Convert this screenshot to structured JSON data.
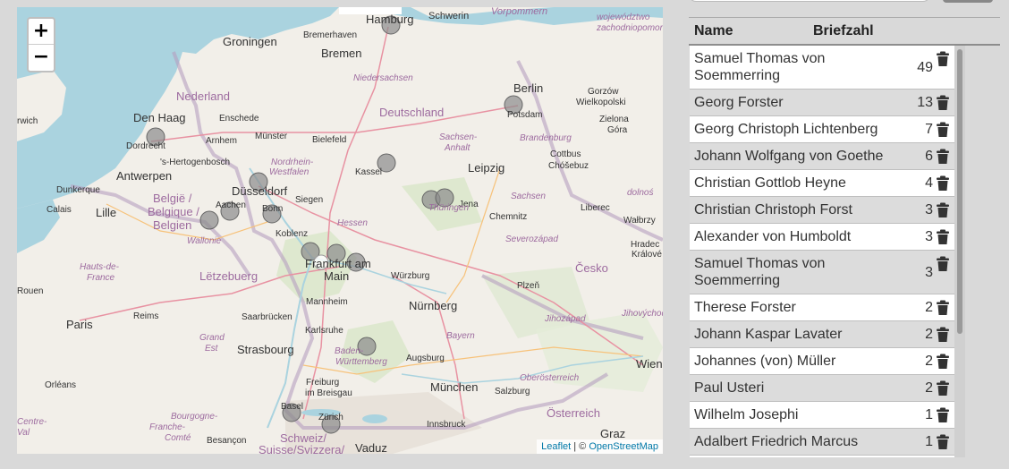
{
  "map": {
    "zoom_in": "+",
    "zoom_out": "−",
    "attribution": {
      "leaflet": "Leaflet",
      "sep": " | © ",
      "osm": "OpenStreetMap"
    },
    "labels": {
      "hamburg": "Hamburg",
      "schwerin": "Schwerin",
      "vorpommern": "Vorpommern",
      "woj": "województwo",
      "woj2": "zachodniopomorskie",
      "groningen": "Groningen",
      "bremerhaven": "Bremerhaven",
      "bremen": "Bremen",
      "nedersaksen": "Nederland",
      "niedersachsen": "Niedersachsen",
      "berlin": "Berlin",
      "potsdam": "Potsdam",
      "gorzow": "Gorzów",
      "wielkopolski": "Wielkopolski",
      "zielona": "Zielona",
      "gora": "Góra",
      "norwich": "rwich",
      "denhaag": "Den Haag",
      "enschede": "Enschede",
      "deutschland": "Deutschland",
      "munster": "Münster",
      "bielefeld": "Bielefeld",
      "dordrecht": "Dordrecht",
      "arnhem": "Arnhem",
      "sachsen_anhalt": "Sachsen-",
      "anhalt": "Anhalt",
      "brandenburg": "Brandenburg",
      "cottbus": "Cottbus",
      "chosebuz": "Chóšebuz",
      "hertogenbosch": "'s-Hertogenbosch",
      "nrw": "Nordrhein-",
      "westfalen": "Westfalen",
      "kassel": "Kassel",
      "leipzig": "Leipzig",
      "antwerpen": "Antwerpen",
      "dunkerque": "Dunkerque",
      "dusseldorf": "Düsseldorf",
      "siegen": "Siegen",
      "jena": "Jena",
      "sachsen": "Sachsen",
      "dolno": "dolnoś",
      "calais": "Calais",
      "lille": "Lille",
      "belgie": "België /",
      "belgique": "Belgique /",
      "belgien": "Belgien",
      "aachen": "Aachen",
      "bonn": "Bonn",
      "hessen": "Hessen",
      "thuringen": "Thüringen",
      "chemnitz": "Chemnitz",
      "liberec": "Liberec",
      "walbrzych": "Wałbrzy",
      "wallonie": "Wallonie",
      "koblenz": "Koblenz",
      "severo": "Severozápad",
      "hradec": "Hradec",
      "kralove": "Králové",
      "hauts": "Hauts-de-",
      "france": "France",
      "letzebuerg": "Lëtzebuerg",
      "frankfurt": "Frankfurt am",
      "main": "Main",
      "wurzburg": "Würzburg",
      "cesko": "Česko",
      "rouen": "Rouen",
      "mannheim": "Mannheim",
      "plzen": "Plzeň",
      "nurnberg": "Nürnberg",
      "paris": "Paris",
      "reims": "Reims",
      "saarbrucken": "Saarbrücken",
      "jihozapad": "Jihozápad",
      "jihovychod": "Jihovýchod",
      "karlsruhe": "Karlsruhe",
      "bayern": "Bayern",
      "grand": "Grand",
      "est": "Est",
      "strasbourg": "Strasbourg",
      "baden": "Baden-",
      "wurttemberg": "Württemberg",
      "augsburg": "Augsburg",
      "wien": "Wien",
      "oberosterreich": "Oberösterreich",
      "orleans": "Orléans",
      "freiburg": "Freiburg",
      "breisgau": "im Breisgau",
      "munchen": "München",
      "salzburg": "Salzburg",
      "basel": "Basel",
      "zurich": "Zürich",
      "innsbruck": "Innsbruck",
      "osterreich": "Österreich",
      "bourgogne": "Bourgogne-",
      "franche": "Franche-",
      "comte": "Comté",
      "besancon": "Besançon",
      "schweiz": "Schweiz/",
      "suisse": "Suisse/Svizzera/",
      "vaduz": "Vaduz",
      "graz": "Graz",
      "centre": "Centre-",
      "val": "Val"
    }
  },
  "table": {
    "header_name": "Name",
    "header_count": "Briefzahl",
    "rows": [
      {
        "name": "Samuel Thomas von Soemmerring",
        "count": "49"
      },
      {
        "name": "Georg Forster",
        "count": "13"
      },
      {
        "name": "Georg Christoph Lichtenberg",
        "count": "7"
      },
      {
        "name": "Johann Wolfgang von Goethe",
        "count": "6"
      },
      {
        "name": "Christian Gottlob Heyne",
        "count": "4"
      },
      {
        "name": "Christian Christoph Forst",
        "count": "3"
      },
      {
        "name": "Alexander von Humboldt",
        "count": "3"
      },
      {
        "name": "Samuel Thomas von Soemmerring",
        "count": "3"
      },
      {
        "name": "Therese Forster",
        "count": "2"
      },
      {
        "name": "Johann Kaspar Lavater",
        "count": "2"
      },
      {
        "name": "Johannes (von) Müller",
        "count": "2"
      },
      {
        "name": "Paul Usteri",
        "count": "2"
      },
      {
        "name": "Wilhelm Josephi",
        "count": "1"
      },
      {
        "name": "Adalbert Friedrich Marcus",
        "count": "1"
      },
      {
        "name": "",
        "count": ""
      }
    ]
  },
  "colors": {
    "water": "#aad3df",
    "land": "#f2efe9",
    "marker": "#8c8c8c",
    "boundary": "#b69ebf"
  }
}
